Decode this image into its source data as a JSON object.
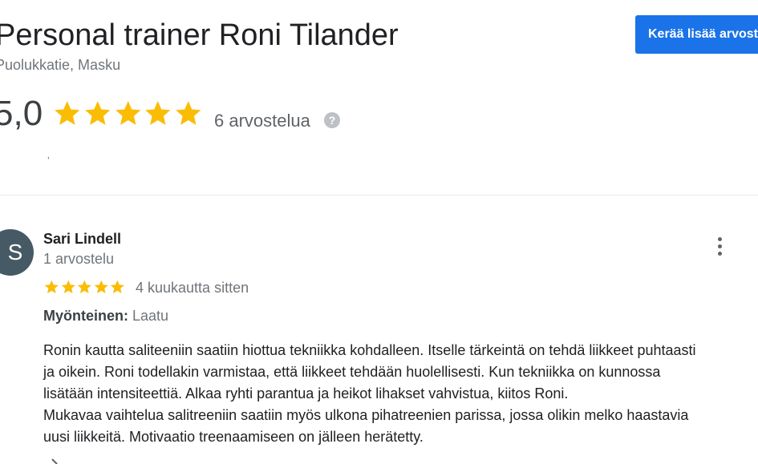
{
  "business": {
    "name": "Personal trainer Roni Tilander",
    "address": "Puolukkatie, Masku",
    "cta_label": "Kerää lisää arvosteluja",
    "rating": "5,0",
    "stars": 5,
    "review_count": "6 arvostelua",
    "help_icon_glyph": "?"
  },
  "review": {
    "avatar_initial": "S",
    "avatar_color": "#455a64",
    "author": "Sari Lindell",
    "author_meta": "1 arvostelu",
    "stars": 5,
    "time": "4 kuukautta sitten",
    "positive_label": "Myönteinen:",
    "positive_value": "Laatu",
    "text_lines": [
      "Ronin kautta saliteeniin saatiin hiottua tekniikka kohdalleen. Itselle tärkeintä on tehdä liikkeet puhtaasti",
      "ja oikein. Roni todellakin varmistaa, että liikkeet tehdään huolellisesti. Kun tekniikka on kunnossa",
      "lisätään intensiteettiä. Alkaa ryhti parantua ja heikot lihakset vahvistua, kiitos Roni.",
      "Mukavaa vaihtelua salitreeniin saatiin myös ulkona pihatreenien parissa, jossa olikin melko haastavia",
      "uusi liikkeitä. Motivaatio treenaamiseen on jälleen herätetty."
    ]
  },
  "colors": {
    "star": "#fbbc04",
    "accent": "#1a73e8"
  },
  "icons": {
    "star": "star-icon",
    "more": "more-vert-icon",
    "help": "help-icon",
    "like": "thumb-up-icon"
  }
}
